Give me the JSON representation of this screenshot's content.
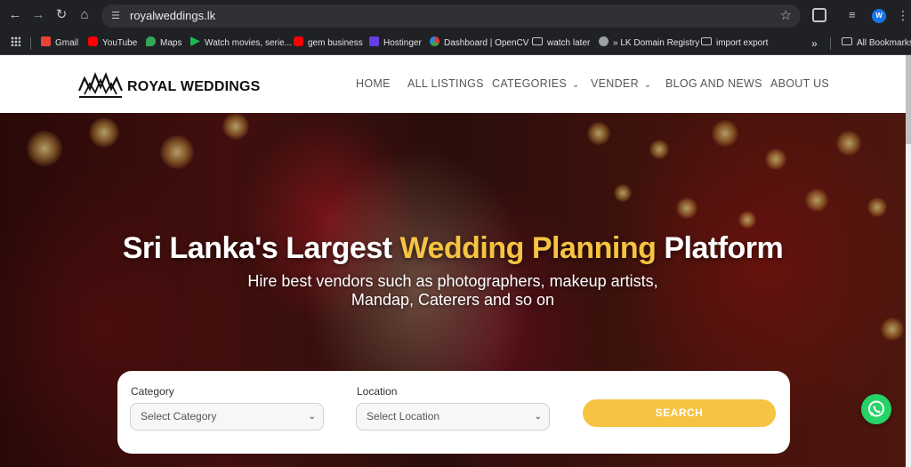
{
  "browser": {
    "url": "royalweddings.lk",
    "profile_initial": "W",
    "bookmarks": [
      {
        "label": "Gmail",
        "color": "#ea4335"
      },
      {
        "label": "YouTube",
        "color": "#ff0000"
      },
      {
        "label": "Maps",
        "color": "#34a853"
      },
      {
        "label": "Watch movies, serie...",
        "color": "#1db954"
      },
      {
        "label": "gem business",
        "color": "#ff0000"
      },
      {
        "label": "Hostinger",
        "color": "#673de6"
      },
      {
        "label": "Dashboard | OpenCV",
        "color": "#e53935"
      },
      {
        "label": "watch later",
        "color": "folder"
      },
      {
        "label": "» LK Domain Registry",
        "color": "#9aa0a6"
      },
      {
        "label": "import export",
        "color": "folder"
      }
    ],
    "more_bookmarks": "»",
    "all_bookmarks": "All Bookmarks"
  },
  "site": {
    "logo_text": "ROYAL WEDDINGS",
    "nav": [
      {
        "label": "HOME",
        "dropdown": false
      },
      {
        "label": "ALL LISTINGS",
        "dropdown": false
      },
      {
        "label": "CATEGORIES",
        "dropdown": true
      },
      {
        "label": "VENDER",
        "dropdown": true
      },
      {
        "label": "BLOG AND NEWS",
        "dropdown": false
      },
      {
        "label": "ABOUT US",
        "dropdown": false
      }
    ],
    "hero": {
      "title_before": "Sri Lanka's Largest ",
      "title_highlight": "Wedding Planning",
      "title_after": " Platform",
      "subtitle_line1": "Hire best vendors such as photographers, makeup artists,",
      "subtitle_line2": "Mandap, Caterers and so on"
    },
    "search": {
      "category_label": "Category",
      "category_value": "Select Category",
      "location_label": "Location",
      "location_value": "Select Location",
      "button_label": "SEARCH"
    },
    "colors": {
      "accent": "#f6c342",
      "whatsapp": "#25d366"
    }
  }
}
